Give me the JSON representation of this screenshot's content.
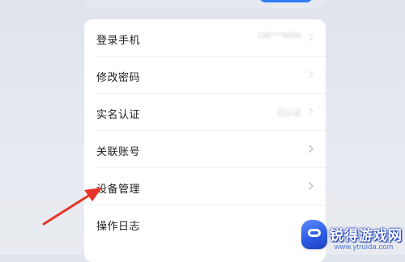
{
  "settings": {
    "items": [
      {
        "label": "登录手机",
        "value": "138****6666",
        "chevron": true
      },
      {
        "label": "修改密码",
        "value": "",
        "chevron": true
      },
      {
        "label": "实名认证",
        "value": "已认证",
        "chevron": true
      },
      {
        "label": "关联账号",
        "value": "",
        "chevron": true
      },
      {
        "label": "设备管理",
        "value": "",
        "chevron": true
      },
      {
        "label": "操作日志",
        "value": "",
        "chevron": false
      }
    ]
  },
  "watermark": {
    "title": "锐得游戏网",
    "url": "www.ytruida.com"
  },
  "colors": {
    "accent": "#2e7cf6",
    "arrow": "#e8332a",
    "background": "#e4e8ef",
    "card": "#ffffff"
  },
  "icons": {
    "chevron": "chevron-right-icon",
    "arrow": "red-arrow-annotation",
    "logo": "ruida-game-logo-icon"
  }
}
